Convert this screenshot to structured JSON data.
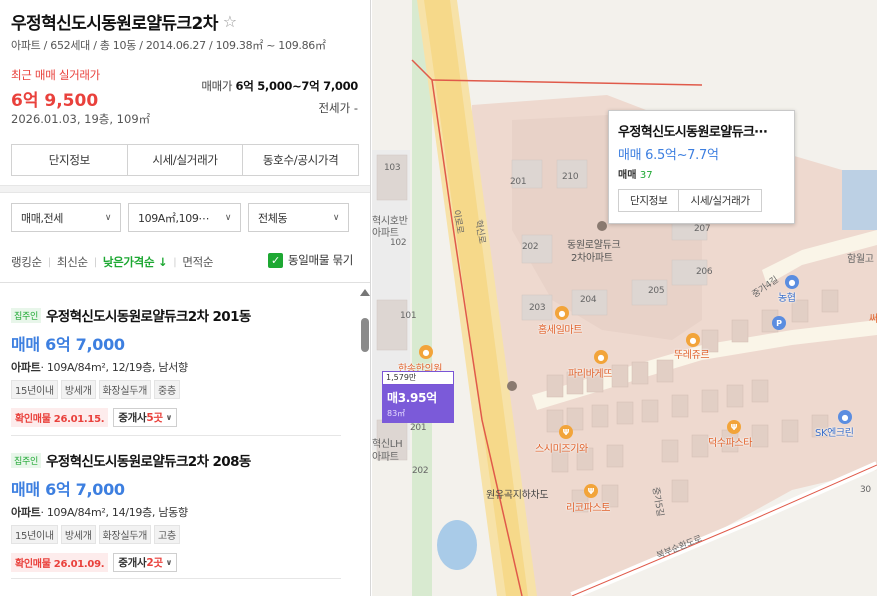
{
  "complex": {
    "title": "우정혁신도시동원로얄듀크2차",
    "specs": "아파트 / 652세대 / 총 10동 / 2014.06.27 / 109.38㎡ ~ 109.86㎡",
    "recent_label": "최근 매매 실거래가",
    "recent_price": "6억 9,500",
    "recent_date": "2026.01.03, 19층, 109㎡",
    "sale_label": "매매가",
    "sale_range": "6억 5,000~7억 7,000",
    "jeonse": "전세가 -"
  },
  "tabs": [
    "단지정보",
    "시세/실거래가",
    "동호수/공시가격"
  ],
  "filters": {
    "trade_type": "매매,전세",
    "area": "109A㎡,109⋯",
    "dong": "전체동"
  },
  "sort": {
    "options": [
      "랭킹순",
      "최신순",
      "낮은가격순 ↓",
      "면적순"
    ],
    "active_index": 2,
    "bundle_label": "동일매물 묶기",
    "bundle_checked": true
  },
  "listings": [
    {
      "owner_badge": "집주인",
      "name": "우정혁신도시동원로얄듀크2차 201동",
      "price": "매매 6억 7,000",
      "type": "아파트",
      "desc": "· 109A/84m², 12/19층, 남서향",
      "tags": [
        "15년이내",
        "방세개",
        "화장실두개",
        "중층"
      ],
      "confirm": "확인매물 26.01.15.",
      "agents_prefix": "중개사 ",
      "agents_count": "5곳"
    },
    {
      "owner_badge": "집주인",
      "name": "우정혁신도시동원로얄듀크2차 208동",
      "price": "매매 6억 7,000",
      "type": "아파트",
      "desc": "· 109A/84m², 14/19층, 남동향",
      "tags": [
        "15년이내",
        "방세개",
        "화장실두개",
        "고층"
      ],
      "confirm": "확인매물 26.01.09.",
      "agents_prefix": "중개사 ",
      "agents_count": "2곳"
    }
  ],
  "map": {
    "popup": {
      "title": "우정혁신도시동원로얄듀크⋯",
      "price": "매매 6.5억~7.7억",
      "count_label": "매매 ",
      "count": "37",
      "btn_info": "단지정보",
      "btn_price": "시세/실거래가"
    },
    "marker": {
      "top": "1,579만",
      "price": "매3.95억",
      "area": "83㎡"
    },
    "labels": {
      "apt_name": "동원로얄듀크",
      "apt_name2": "2차아파트",
      "road_center": "이로로",
      "road_center2": "혁신로",
      "left_apt1": "혁시호반",
      "left_apt2": "아파트",
      "left_apt3": "혁신LH",
      "left_apt4": "아파트",
      "underpass": "원유곡지하차도",
      "bottom_road": "북부순환도로",
      "side_road": "중가4길",
      "side_road2": "중가5길",
      "hamwol": "함월고",
      "sseo": "써",
      "b103": "103",
      "b102": "102",
      "b101": "101",
      "b201a": "201",
      "b210": "210",
      "b202": "202",
      "b207": "207",
      "b206": "206",
      "b204": "204",
      "b205": "205",
      "b203": "203",
      "b201b": "201",
      "b202b": "202",
      "b30": "30"
    },
    "pois": {
      "homesale": "홈세일마트",
      "hanssong": "한송한의원",
      "nonghyup": "농협",
      "parisb": "파리바게뜨",
      "tourles": "뚜레쥬르",
      "sushi": "스시미즈기와",
      "sk": "SK엔크린",
      "duksu": "덕수파스타",
      "ricco": "리코파스토"
    }
  },
  "colors": {
    "accent_green": "#1ea833",
    "price_blue": "#3d7fe0",
    "alert_red": "#e9413c",
    "marker_purple": "#7b5ad9"
  }
}
